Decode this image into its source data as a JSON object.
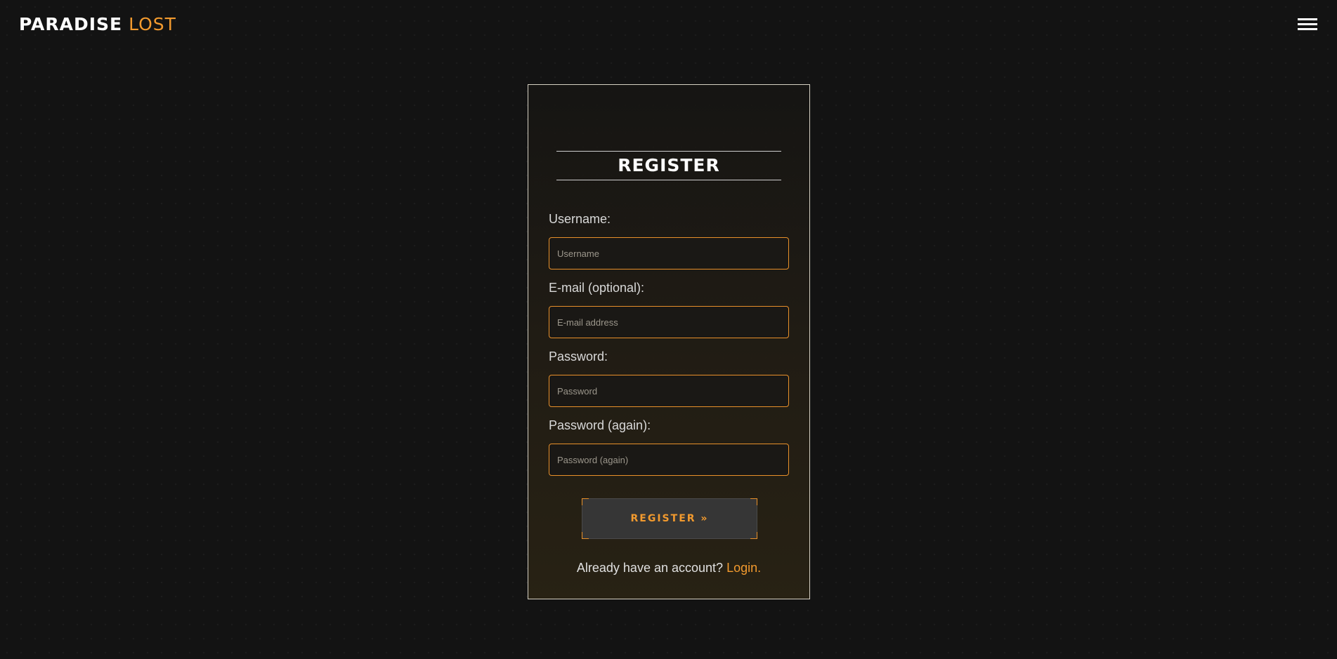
{
  "header": {
    "logo_primary": "PARADISE",
    "logo_accent": "LOST",
    "menu_icon": "hamburger-menu-icon"
  },
  "register_form": {
    "title": "REGISTER",
    "fields": [
      {
        "label": "Username:",
        "placeholder": "Username",
        "value": ""
      },
      {
        "label": "E-mail (optional):",
        "placeholder": "E-mail address",
        "value": ""
      },
      {
        "label": "Password:",
        "placeholder": "Password",
        "value": ""
      },
      {
        "label": "Password (again):",
        "placeholder": "Password (again)",
        "value": ""
      }
    ],
    "submit_label": "REGISTER »",
    "login_prompt": "Already have an account?",
    "login_link": "Login."
  },
  "colors": {
    "background": "#131313",
    "accent": "#f29a2e",
    "input_border": "#e8902a",
    "button_bg": "#363636",
    "card_border": "#d6d1c4"
  }
}
